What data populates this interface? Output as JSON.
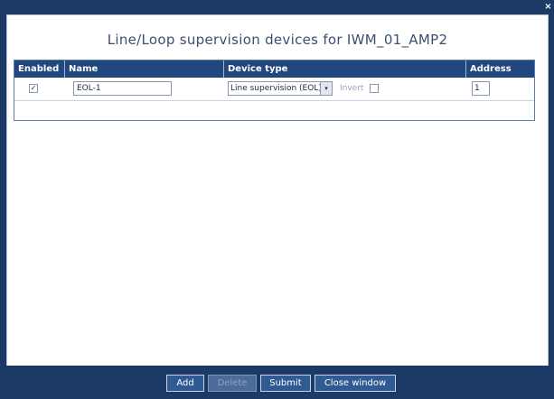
{
  "window": {
    "close_glyph": "×"
  },
  "dialog": {
    "title": "Line/Loop supervision devices for IWM_01_AMP2"
  },
  "table": {
    "headers": {
      "enabled": "Enabled",
      "name": "Name",
      "device_type": "Device type",
      "address": "Address"
    },
    "rows": [
      {
        "enabled": true,
        "enabled_mark": "✓",
        "name": "EOL-1",
        "device_type": "Line supervision (EOL)",
        "select_arrow": "▾",
        "invert_label": "Invert",
        "invert": false,
        "address": "1"
      }
    ]
  },
  "footer": {
    "add_label": "Add",
    "delete_label": "Delete",
    "submit_label": "Submit",
    "close_label": "Close window"
  },
  "colors": {
    "chrome": "#1c3a66",
    "header": "#21487d",
    "panel": "#ffffff",
    "title_text": "#3b4f73"
  }
}
